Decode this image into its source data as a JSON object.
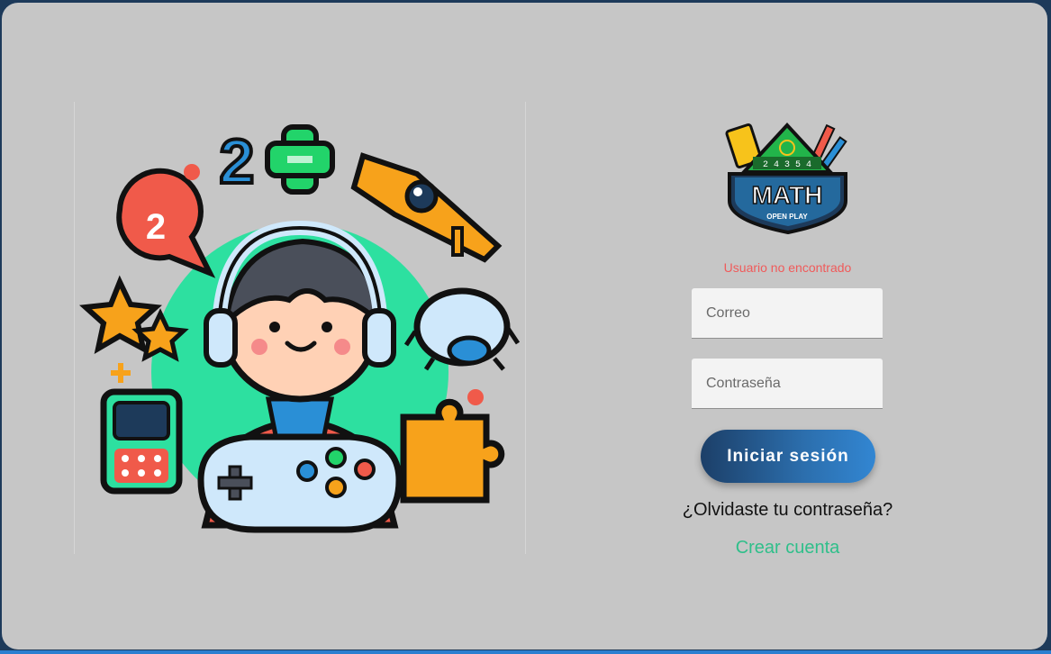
{
  "illustration": {
    "numbers": [
      "2",
      "2"
    ],
    "plus": "+",
    "accent_colors": {
      "green_circle": "#2de0a0",
      "red": "#f05a4a",
      "orange": "#f7a21b",
      "blue": "#2a8fd6"
    }
  },
  "logo": {
    "title": "MATH",
    "subtitle": "OPEN PLAY",
    "board_numbers": "2 4 3 5 4"
  },
  "login": {
    "error": "Usuario no encontrado",
    "email_placeholder": "Correo",
    "password_placeholder": "Contraseña",
    "submit_label": "Iniciar sesión",
    "forgot_label": "¿Olvidaste tu contraseña?",
    "create_label": "Crear cuenta",
    "colors": {
      "error": "#f05a5a",
      "link": "#2fbf8a",
      "button_start": "#1c3f68",
      "button_end": "#3286d2",
      "background": "#c6c6c6"
    }
  }
}
